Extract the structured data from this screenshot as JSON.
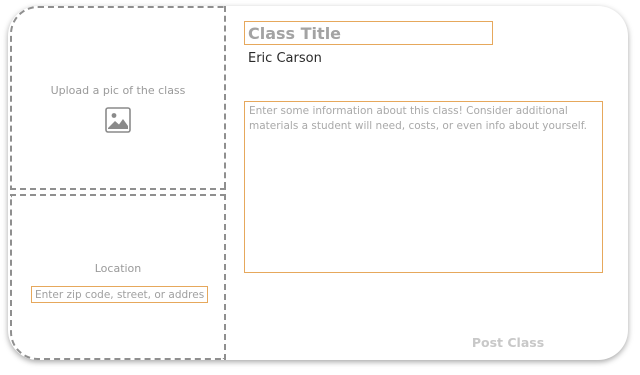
{
  "upload": {
    "label": "Upload a pic of the class",
    "icon": "image-icon"
  },
  "location": {
    "label": "Location",
    "placeholder": "Enter zip code, street, or address"
  },
  "class_form": {
    "title_placeholder": "Class Title",
    "author": "Eric Carson",
    "description_placeholder": "Enter some information about this class! Consider additional materials a student will need, costs, or even info about yourself."
  },
  "actions": {
    "post_label": "Post Class"
  },
  "colors": {
    "input_border": "#e6a85c",
    "dashed_border": "#8f8f8f",
    "muted_text": "#9a9a9a",
    "disabled_button": "#c8c8c8"
  }
}
